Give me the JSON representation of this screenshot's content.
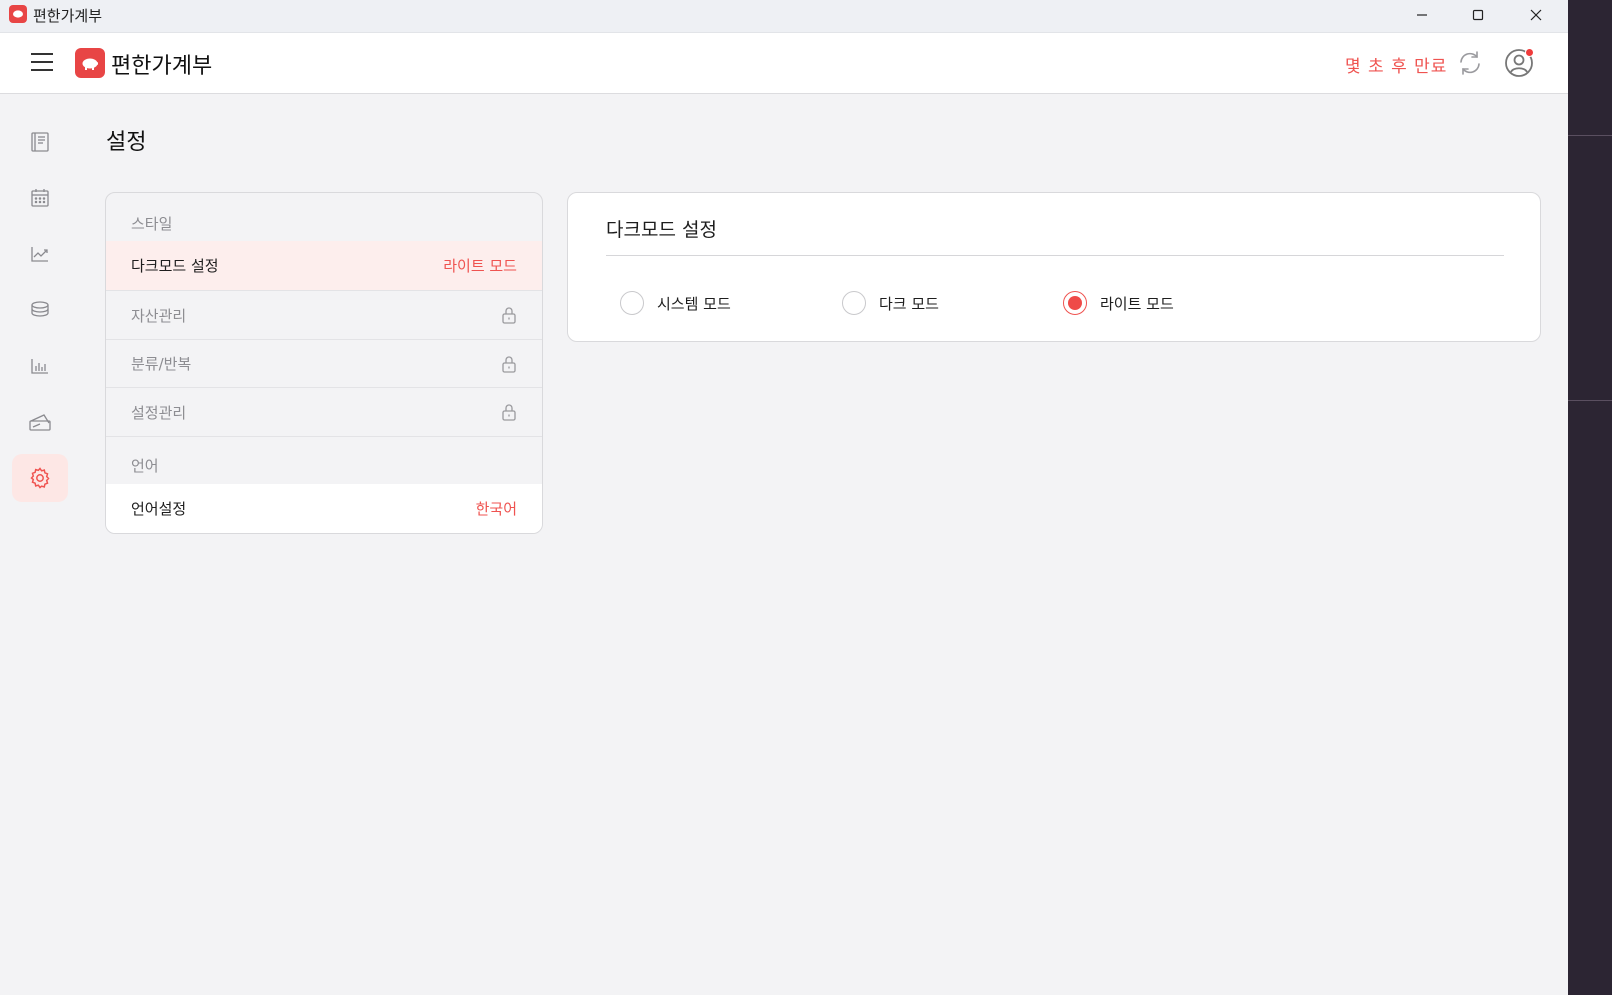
{
  "titlebar": {
    "title": "편한가계부",
    "minimize_icon": "minimize-icon",
    "maximize_icon": "maximize-icon",
    "close_icon": "close-icon"
  },
  "header": {
    "brand": "편한가계부",
    "expiry_text": "몇 초 후 만료",
    "icons": [
      "menu-icon",
      "piggy-bank-logo",
      "refresh-icon",
      "user-profile-icon"
    ]
  },
  "sidenav": {
    "items": [
      {
        "name": "ledger",
        "icon": "book-icon",
        "active": false
      },
      {
        "name": "calendar",
        "icon": "calendar-icon",
        "active": false
      },
      {
        "name": "trend",
        "icon": "trend-chart-icon",
        "active": false
      },
      {
        "name": "assets",
        "icon": "coins-icon",
        "active": false
      },
      {
        "name": "statistics",
        "icon": "bar-chart-icon",
        "active": false
      },
      {
        "name": "budget",
        "icon": "card-icon",
        "active": false
      },
      {
        "name": "settings",
        "icon": "gear-icon",
        "active": true
      }
    ]
  },
  "page": {
    "title": "설정"
  },
  "settings_menu": {
    "style_section": "스타일",
    "dark_mode_label": "다크모드 설정",
    "dark_mode_value": "라이트 모드",
    "asset_label": "자산관리",
    "category_label": "분류/반복",
    "settings_manage_label": "설정관리",
    "language_section": "언어",
    "language_label": "언어설정",
    "language_value": "한국어"
  },
  "dark_mode_card": {
    "title": "다크모드 설정",
    "options": [
      {
        "label": "시스템 모드",
        "checked": false
      },
      {
        "label": "다크 모드",
        "checked": false
      },
      {
        "label": "라이트 모드",
        "checked": true
      }
    ]
  },
  "colors": {
    "accent": "#ef5350",
    "brand": "#e84545",
    "selected_row_bg": "#fdeeed"
  }
}
